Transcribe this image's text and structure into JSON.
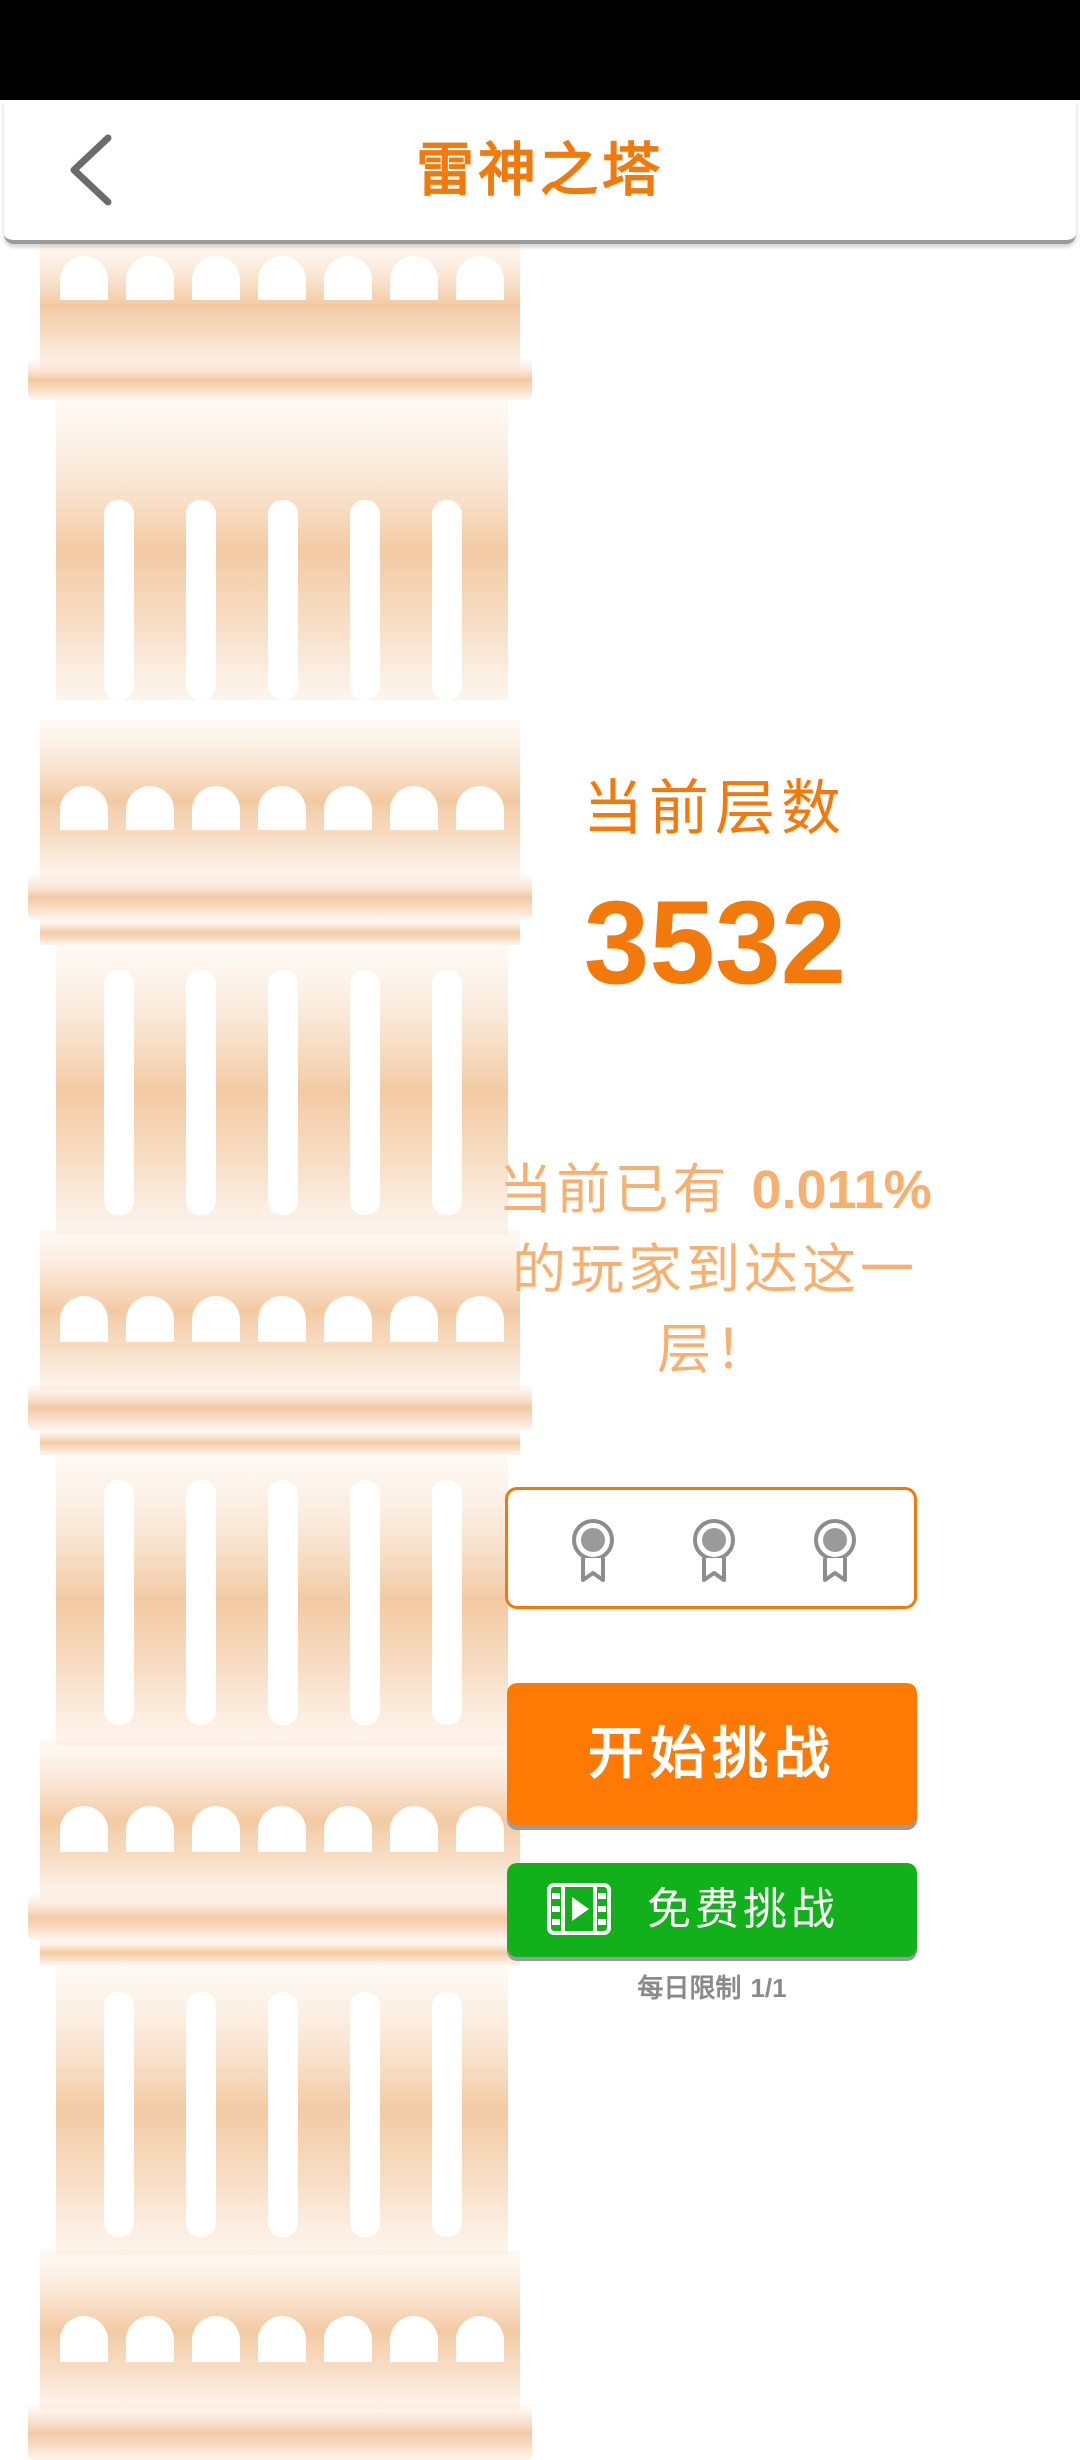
{
  "header": {
    "title": "雷神之塔"
  },
  "tower_status": {
    "floor_label": "当前层数",
    "floor_number": "3532",
    "reach_prefix": "当前已有",
    "reach_percent": "0.011%",
    "reach_suffix": "的玩家到达这一层！"
  },
  "rewards": {
    "medals": [
      "medal-icon",
      "medal-icon",
      "medal-icon"
    ]
  },
  "actions": {
    "start_label": "开始挑战",
    "free_label": "免费挑战",
    "daily_limit_label": "每日限制",
    "daily_limit_value": "1/1"
  },
  "colors": {
    "accent": "#F27A0D",
    "start_button": "#FF7A05",
    "free_button": "#12B01A",
    "status_bar": "#000000"
  }
}
